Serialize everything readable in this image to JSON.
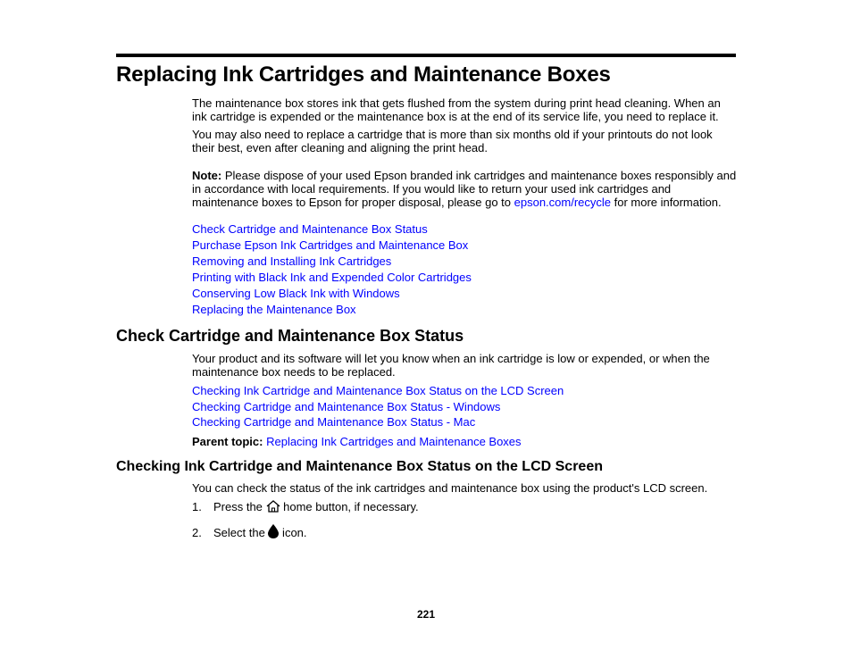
{
  "page": {
    "title": "Replacing Ink Cartridges and Maintenance Boxes",
    "intro_paragraphs": [
      "The maintenance box stores ink that gets flushed from the system during print head cleaning. When an ink cartridge is expended or the maintenance box is at the end of its service life, you need to replace it.",
      "You may also need to replace a cartridge that is more than six months old if your printouts do not look their best, even after cleaning and aligning the print head."
    ],
    "note": {
      "label": "Note:",
      "text_before": " Please dispose of your used Epson branded ink cartridges and maintenance boxes responsibly and in accordance with local requirements. If you would like to return your used ink cartridges and maintenance boxes to Epson for proper disposal, please go to ",
      "link": "epson.com/recycle",
      "text_after": " for more information."
    },
    "topic_links": [
      "Check Cartridge and Maintenance Box Status",
      "Purchase Epson Ink Cartridges and Maintenance Box",
      "Removing and Installing Ink Cartridges",
      "Printing with Black Ink and Expended Color Cartridges",
      "Conserving Low Black Ink with Windows",
      "Replacing the Maintenance Box"
    ],
    "section1": {
      "heading": "Check Cartridge and Maintenance Box Status",
      "paragraph": "Your product and its software will let you know when an ink cartridge is low or expended, or when the maintenance box needs to be replaced.",
      "links": [
        "Checking Ink Cartridge and Maintenance Box Status on the LCD Screen",
        "Checking Cartridge and Maintenance Box Status - Windows",
        "Checking Cartridge and Maintenance Box Status - Mac"
      ],
      "parent_label": "Parent topic:",
      "parent_link": "Replacing Ink Cartridges and Maintenance Boxes"
    },
    "section2": {
      "heading": "Checking Ink Cartridge and Maintenance Box Status on the LCD Screen",
      "paragraph": "You can check the status of the ink cartridges and maintenance box using the product's LCD screen.",
      "steps": [
        {
          "num": "1.",
          "before": "Press the ",
          "icon": "home-icon",
          "after": " home button, if necessary."
        },
        {
          "num": "2.",
          "before": "Select the ",
          "icon": "ink-drop-icon",
          "after": " icon."
        }
      ]
    },
    "page_number": "221",
    "colors": {
      "link": "#0000ff",
      "text": "#000000",
      "rule": "#000000"
    }
  }
}
